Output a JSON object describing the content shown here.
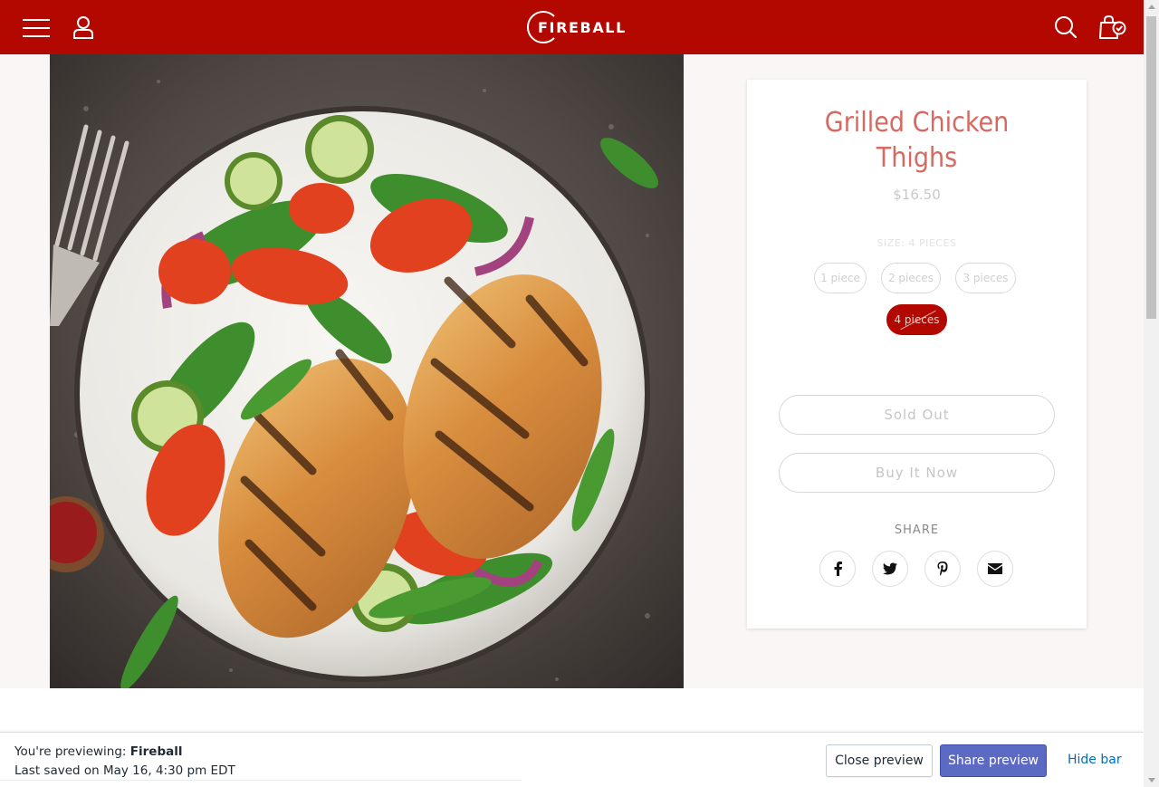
{
  "header": {
    "brand": "FIREBALL",
    "background": "#b30800",
    "menu_icon": "hamburger-menu-icon",
    "account_icon": "user-account-icon",
    "search_icon": "search-icon",
    "cart_icon": "shopping-bag-check-icon"
  },
  "product": {
    "image_alt": "Grilled chicken thighs with salad on a plate",
    "title_line1": "Grilled Chicken",
    "title_line2": "Thighs",
    "price": "$16.50",
    "size_label": "SIZE: 4 PIECES",
    "sizes": [
      "1 piece",
      "2 pieces",
      "3 pieces",
      "4 pieces"
    ],
    "selected_size": "4 pieces",
    "sold_out_label": "Sold Out",
    "buy_now_label": "Buy It Now",
    "share_label": "SHARE",
    "share_icons": [
      "facebook-icon",
      "twitter-icon",
      "pinterest-icon",
      "email-icon"
    ],
    "title_color": "#d66a63"
  },
  "preview_bar": {
    "previewing_prefix": "You're previewing:",
    "store_name": "Fireball",
    "last_saved": "Last saved on May 16, 4:30 pm EDT",
    "close_label": "Close preview",
    "share_label": "Share preview",
    "hide_label": "Hide bar",
    "share_color": "#5c6ac4"
  }
}
